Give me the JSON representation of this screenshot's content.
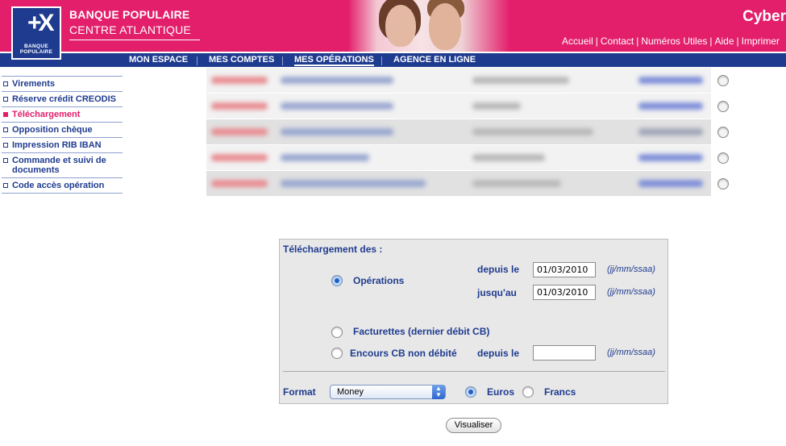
{
  "header": {
    "bank_name": "BANQUE POPULAIRE",
    "bank_sub": "CENTRE ATLANTIQUE",
    "logo_symbol": "+X",
    "logo_text_1": "BANQUE",
    "logo_text_2": "POPULAIRE",
    "cyber": "Cyber",
    "links": [
      "Accueil",
      "Contact",
      "Numéros Utiles",
      "Aide",
      "Imprimer"
    ],
    "link_separator": "|",
    "brand_color": "#e31f6c",
    "nav_color": "#1f3b8f"
  },
  "nav": {
    "items": [
      {
        "label": "MON ESPACE"
      },
      {
        "label": "MES COMPTES"
      },
      {
        "label": "MES OPÉRATIONS",
        "active": true
      },
      {
        "label": "AGENCE EN LIGNE"
      }
    ]
  },
  "sidebar": {
    "items": [
      {
        "label": "Virements"
      },
      {
        "label": "Réserve crédit CREODIS"
      },
      {
        "label": "Téléchargement",
        "active": true
      },
      {
        "label": "Opposition chèque"
      },
      {
        "label": "Impression RIB IBAN"
      },
      {
        "label": "Commande et suivi de documents"
      },
      {
        "label": "Code accès opération"
      }
    ]
  },
  "accounts": {
    "row_count_note": "5 blurred account rows, each with an unselected radio button"
  },
  "form": {
    "title": "Téléchargement des :",
    "operations_label": "Opérations",
    "depuis_le": "depuis le",
    "jusqu_au": "jusqu'au",
    "from_date": "01/03/2010",
    "to_date": "01/03/2010",
    "date_hint": "(jj/mm/ssaa)",
    "facturettes_label": "Facturettes (dernier débit CB)",
    "encours_label": "Encours CB non débité",
    "encours_depuis": "depuis le",
    "encours_date": "",
    "format_label": "Format",
    "format_value": "Money",
    "euros_label": "Euros",
    "francs_label": "Francs",
    "selected_type": "operations",
    "selected_currency": "euros"
  },
  "actions": {
    "visualiser": "Visualiser"
  }
}
